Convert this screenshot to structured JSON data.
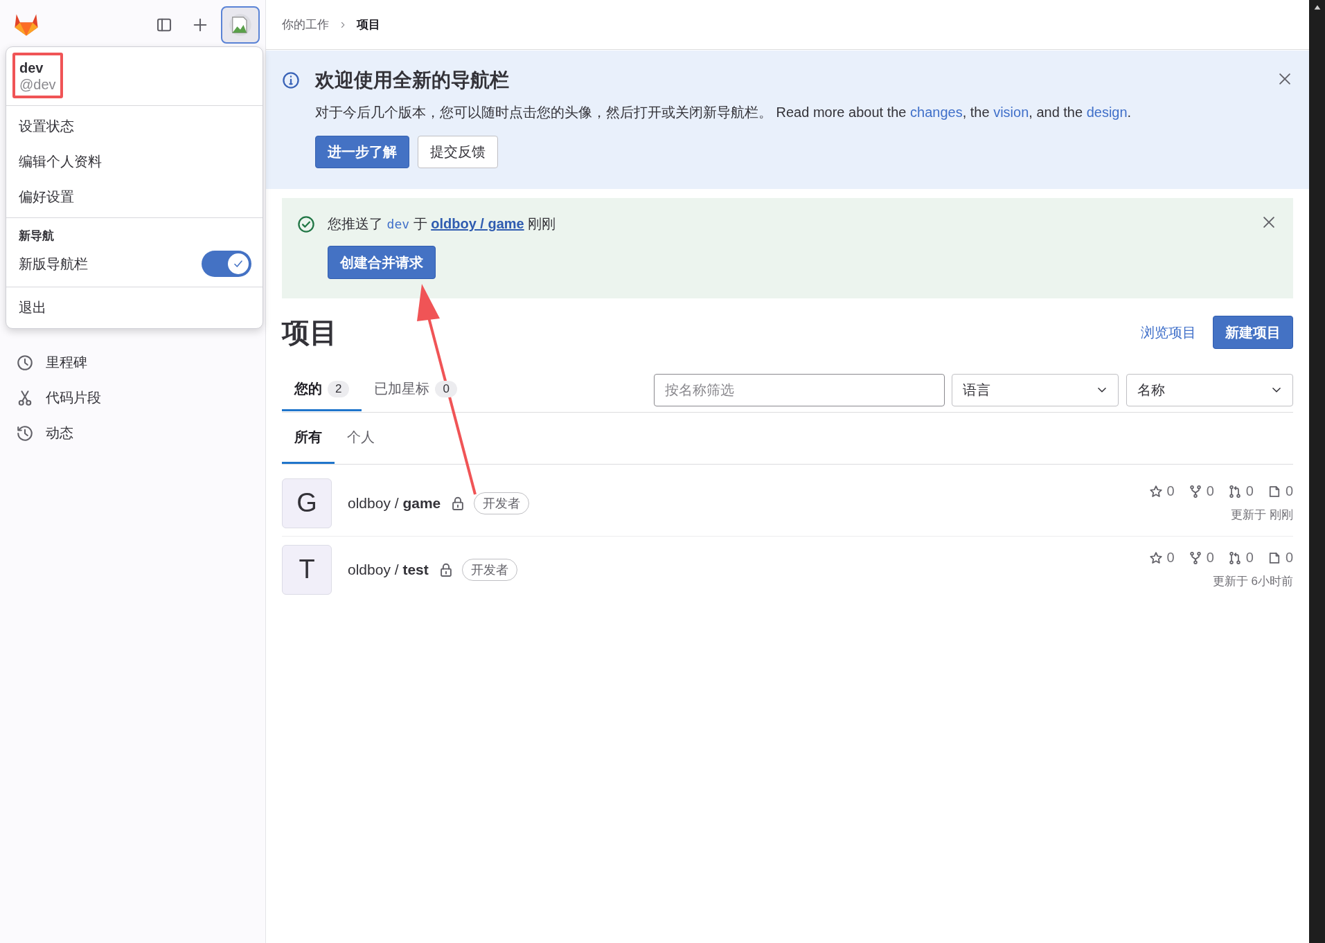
{
  "sidebar": {
    "items": [
      {
        "label": "里程碑"
      },
      {
        "label": "代码片段"
      },
      {
        "label": "动态"
      }
    ]
  },
  "user_menu": {
    "name": "dev",
    "username": "@dev",
    "items": [
      "设置状态",
      "编辑个人资料",
      "偏好设置"
    ],
    "section_title": "新导航",
    "toggle": {
      "label": "新版导航栏",
      "on": true
    },
    "sign_out": "退出"
  },
  "breadcrumb": [
    {
      "label": "你的工作",
      "current": false
    },
    {
      "label": "项目",
      "current": true
    }
  ],
  "banner": {
    "title": "欢迎使用全新的导航栏",
    "text": [
      {
        "text": "对于今后几个版本，您可以随时点击您的头像，然后打开或关闭新导航栏。 Read more about the ",
        "kind": "plain"
      },
      {
        "text": "changes",
        "kind": "link"
      },
      {
        "text": ", the ",
        "kind": "plain"
      },
      {
        "text": "vision",
        "kind": "link"
      },
      {
        "text": ", and the ",
        "kind": "plain"
      },
      {
        "text": "design",
        "kind": "link"
      },
      {
        "text": ".",
        "kind": "plain"
      }
    ],
    "buttons": [
      {
        "label": "进一步了解",
        "kind": "primary"
      },
      {
        "label": "提交反馈",
        "kind": "secondary"
      }
    ]
  },
  "alert": {
    "text": [
      {
        "text": "您推送了 ",
        "kind": "plain"
      },
      {
        "text": "dev",
        "kind": "code"
      },
      {
        "text": " 于 ",
        "kind": "plain"
      },
      {
        "text": "oldboy / game",
        "kind": "link"
      },
      {
        "text": " 刚刚",
        "kind": "plain"
      }
    ],
    "button": "创建合并请求"
  },
  "page": {
    "title": "项目",
    "browse": "浏览项目",
    "new_button": "新建项目"
  },
  "tabs": [
    {
      "label": "您的",
      "count": "2",
      "selected": true
    },
    {
      "label": "已加星标",
      "count": "0",
      "selected": false
    }
  ],
  "filter": {
    "placeholder": "按名称筛选"
  },
  "dropdowns": [
    "语言",
    "名称"
  ],
  "subtabs": [
    {
      "label": "所有",
      "selected": true
    },
    {
      "label": "个人",
      "selected": false
    }
  ],
  "projects": [
    {
      "avatar": "G",
      "title": "oldboy / **game**",
      "role": "开发者",
      "stats": [
        "0",
        "0",
        "0",
        "0"
      ],
      "updated": "更新于 刚刚"
    },
    {
      "avatar": "T",
      "title": "oldboy / **test**",
      "role": "开发者",
      "stats": [
        "0",
        "0",
        "0",
        "0"
      ],
      "updated": "更新于 6小时前"
    }
  ]
}
